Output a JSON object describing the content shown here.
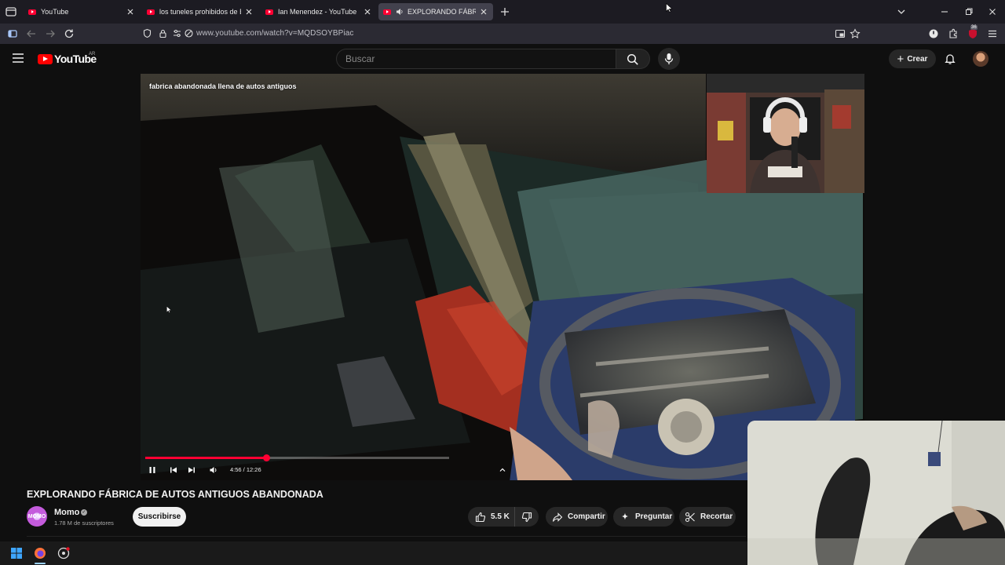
{
  "browser": {
    "tabs": [
      {
        "title": "YouTube",
        "active": false
      },
      {
        "title": "los tuneles prohibidos de Buenos Aires",
        "active": false
      },
      {
        "title": "Ian Menendez - YouTube",
        "active": false
      },
      {
        "title": "EXPLORANDO FÁBRICA DE AUTOS ANTIGUOS ABANDONADA",
        "active": true,
        "audio": true
      }
    ],
    "url": "www.youtube.com/watch?v=MQDSOYBPiac",
    "extension_badge": "36"
  },
  "masthead": {
    "logo_text": "YouTube",
    "region": "AR",
    "search_placeholder": "Buscar",
    "create_label": "Crear"
  },
  "player": {
    "overlay_title": "fabrica abandonada llena de autos antiguos",
    "time_display": "4:56 / 12:26",
    "progress_fraction": 0.397,
    "buffered_fraction": 0.47
  },
  "video": {
    "title": "EXPLORANDO FÁBRICA DE AUTOS ANTIGUOS ABANDONADA",
    "channel_name": "Momo",
    "channel_avatar_text": "MOMO",
    "subscribers": "1.78 M de suscriptores",
    "subscribe_label": "Suscribirse",
    "likes": "5.5 K",
    "share_label": "Compartir",
    "ask_label": "Preguntar",
    "clip_label": "Recortar"
  },
  "colors": {
    "brand_red": "#ff0033",
    "background": "#0f0f0f",
    "pill_bg": "#272727"
  }
}
